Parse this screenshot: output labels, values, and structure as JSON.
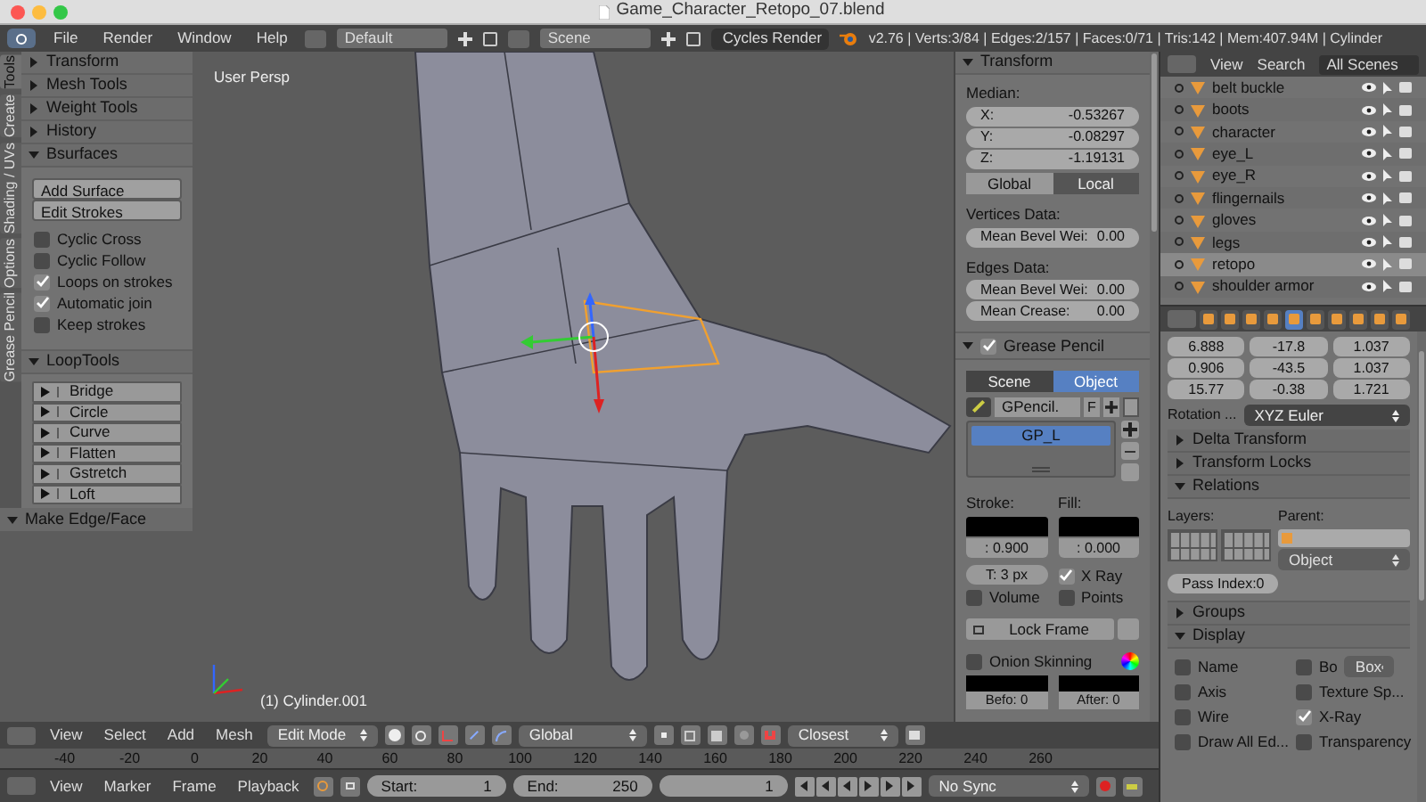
{
  "window": {
    "title": "Game_Character_Retopo_07.blend"
  },
  "info_header": {
    "menus": [
      "File",
      "Render",
      "Window",
      "Help"
    ],
    "screen_layout": "Default",
    "scene": "Scene",
    "render_engine": "Cycles Render",
    "stats": "v2.76 | Verts:3/84 | Edges:2/157 | Faces:0/71 | Tris:142 | Mem:407.94M | Cylinder"
  },
  "tool_tabs": [
    {
      "label": "Tools",
      "selected": true
    },
    {
      "label": "Create",
      "selected": false
    },
    {
      "label": "Shading / UVs",
      "selected": false
    },
    {
      "label": "Options",
      "selected": false
    },
    {
      "label": "Grease Pencil",
      "selected": false
    }
  ],
  "tool_panel": {
    "collapsed_sections": [
      {
        "title": "Transform",
        "expanded": false
      },
      {
        "title": "Mesh Tools",
        "expanded": false
      },
      {
        "title": "Weight Tools",
        "expanded": false
      },
      {
        "title": "History",
        "expanded": false
      }
    ],
    "bsurfaces": {
      "title": "Bsurfaces",
      "expanded": true,
      "buttons": [
        "Add Surface",
        "Edit Strokes"
      ],
      "options": [
        {
          "label": "Cyclic Cross",
          "checked": false
        },
        {
          "label": "Cyclic Follow",
          "checked": false
        },
        {
          "label": "Loops on strokes",
          "checked": true
        },
        {
          "label": "Automatic join",
          "checked": true
        },
        {
          "label": "Keep strokes",
          "checked": false
        }
      ]
    },
    "looptools": {
      "title": "LoopTools",
      "expanded": true,
      "items": [
        "Bridge",
        "Circle",
        "Curve",
        "Flatten",
        "Gstretch",
        "Loft"
      ]
    },
    "operator_panel": {
      "title": "Make Edge/Face",
      "expanded": true
    }
  },
  "viewport": {
    "view_label": "User Persp",
    "object_label": "(1) Cylinder.001"
  },
  "n_panel": {
    "transform": {
      "title": "Transform",
      "expanded": true,
      "median_label": "Median:",
      "median": [
        {
          "label": "X:",
          "value": "-0.53267"
        },
        {
          "label": "Y:",
          "value": "-0.08297"
        },
        {
          "label": "Z:",
          "value": "-1.19131"
        }
      ],
      "spaces": [
        {
          "label": "Global",
          "selected": false
        },
        {
          "label": "Local",
          "selected": true
        }
      ],
      "vertices_label": "Vertices Data:",
      "vertices": [
        {
          "label": "Mean Bevel Wei:",
          "value": "0.00"
        }
      ],
      "edges_label": "Edges Data:",
      "edges": [
        {
          "label": "Mean Bevel Wei:",
          "value": "0.00"
        },
        {
          "label": "Mean Crease:",
          "value": "0.00"
        }
      ]
    },
    "grease_pencil": {
      "title": "Grease Pencil",
      "enabled": true,
      "expanded": true,
      "sources": [
        {
          "label": "Scene",
          "selected": false
        },
        {
          "label": "Object",
          "selected": true
        }
      ],
      "datablock": "GPencil.",
      "fake_user": "F",
      "layers": [
        {
          "name": "GP_L",
          "selected": true
        }
      ],
      "stroke_label": "Stroke:",
      "fill_label": "Fill:",
      "stroke_opacity": ": 0.900",
      "fill_opacity": ": 0.000",
      "thickness": "T: 3 px",
      "options": [
        {
          "label": "X Ray",
          "checked": true
        },
        {
          "label": "Volume",
          "checked": false
        },
        {
          "label": "Points",
          "checked": false
        }
      ],
      "lock_frame": "Lock Frame",
      "onion": {
        "label": "Onion Skinning",
        "checked": false
      },
      "before": "Befo: 0",
      "after": "After: 0"
    }
  },
  "outliner": {
    "menus": [
      "View",
      "Search"
    ],
    "filter": "All Scenes",
    "items": [
      {
        "name": "belt buckle",
        "selected": false
      },
      {
        "name": "boots",
        "selected": false
      },
      {
        "name": "character",
        "selected": false
      },
      {
        "name": "eye_L",
        "selected": false
      },
      {
        "name": "eye_R",
        "selected": false
      },
      {
        "name": "flingernails",
        "selected": false
      },
      {
        "name": "gloves",
        "selected": false
      },
      {
        "name": "legs",
        "selected": false
      },
      {
        "name": "retopo",
        "selected": true
      },
      {
        "name": "shoulder armor",
        "selected": false
      }
    ]
  },
  "properties": {
    "tabs": [
      {
        "selected": false
      },
      {
        "selected": false
      },
      {
        "selected": false
      },
      {
        "selected": false
      },
      {
        "selected": true
      },
      {
        "selected": false
      },
      {
        "selected": false
      },
      {
        "selected": false
      },
      {
        "selected": false
      },
      {
        "selected": false
      }
    ],
    "location": [
      "6.888",
      "0.906",
      "15.77"
    ],
    "rotation": [
      "-17.8",
      "-43.5",
      "-0.38"
    ],
    "scale": [
      "1.037",
      "1.037",
      "1.721"
    ],
    "rotation_mode_label": "Rotation ...",
    "rotation_mode": "XYZ Euler",
    "sections_before": [
      {
        "title": "Delta Transform",
        "expanded": false
      },
      {
        "title": "Transform Locks",
        "expanded": false
      }
    ],
    "relations": {
      "title": "Relations",
      "expanded": true,
      "layers_label": "Layers:",
      "parent_label": "Parent:",
      "parent_type": "Object",
      "pass_index": "Pass Index:0"
    },
    "groups": {
      "title": "Groups",
      "expanded": false
    },
    "display": {
      "title": "Display",
      "expanded": true,
      "bounds_type": "Box",
      "options": [
        {
          "label": "Name",
          "checked": false
        },
        {
          "label": "Bo",
          "checked": false
        },
        {
          "label": "Axis",
          "checked": false
        },
        {
          "label": "Texture Sp...",
          "checked": false
        },
        {
          "label": "Wire",
          "checked": false
        },
        {
          "label": "X-Ray",
          "checked": true
        },
        {
          "label": "Draw All Ed...",
          "checked": false
        },
        {
          "label": "Transparency",
          "checked": false
        }
      ]
    }
  },
  "viewport_header": {
    "menus": [
      "View",
      "Select",
      "Add",
      "Mesh"
    ],
    "mode": "Edit Mode",
    "orientation": "Global",
    "snap_target": "Closest"
  },
  "timeline_ruler": [
    "-40",
    "-20",
    "0",
    "20",
    "40",
    "60",
    "80",
    "100",
    "120",
    "140",
    "160",
    "180",
    "200",
    "220",
    "240",
    "260"
  ],
  "timeline_header": {
    "menus": [
      "View",
      "Marker",
      "Frame",
      "Playback"
    ],
    "start_label": "Start:",
    "start": "1",
    "end_label": "End:",
    "end": "250",
    "current_frame": "1",
    "sync": "No Sync"
  }
}
